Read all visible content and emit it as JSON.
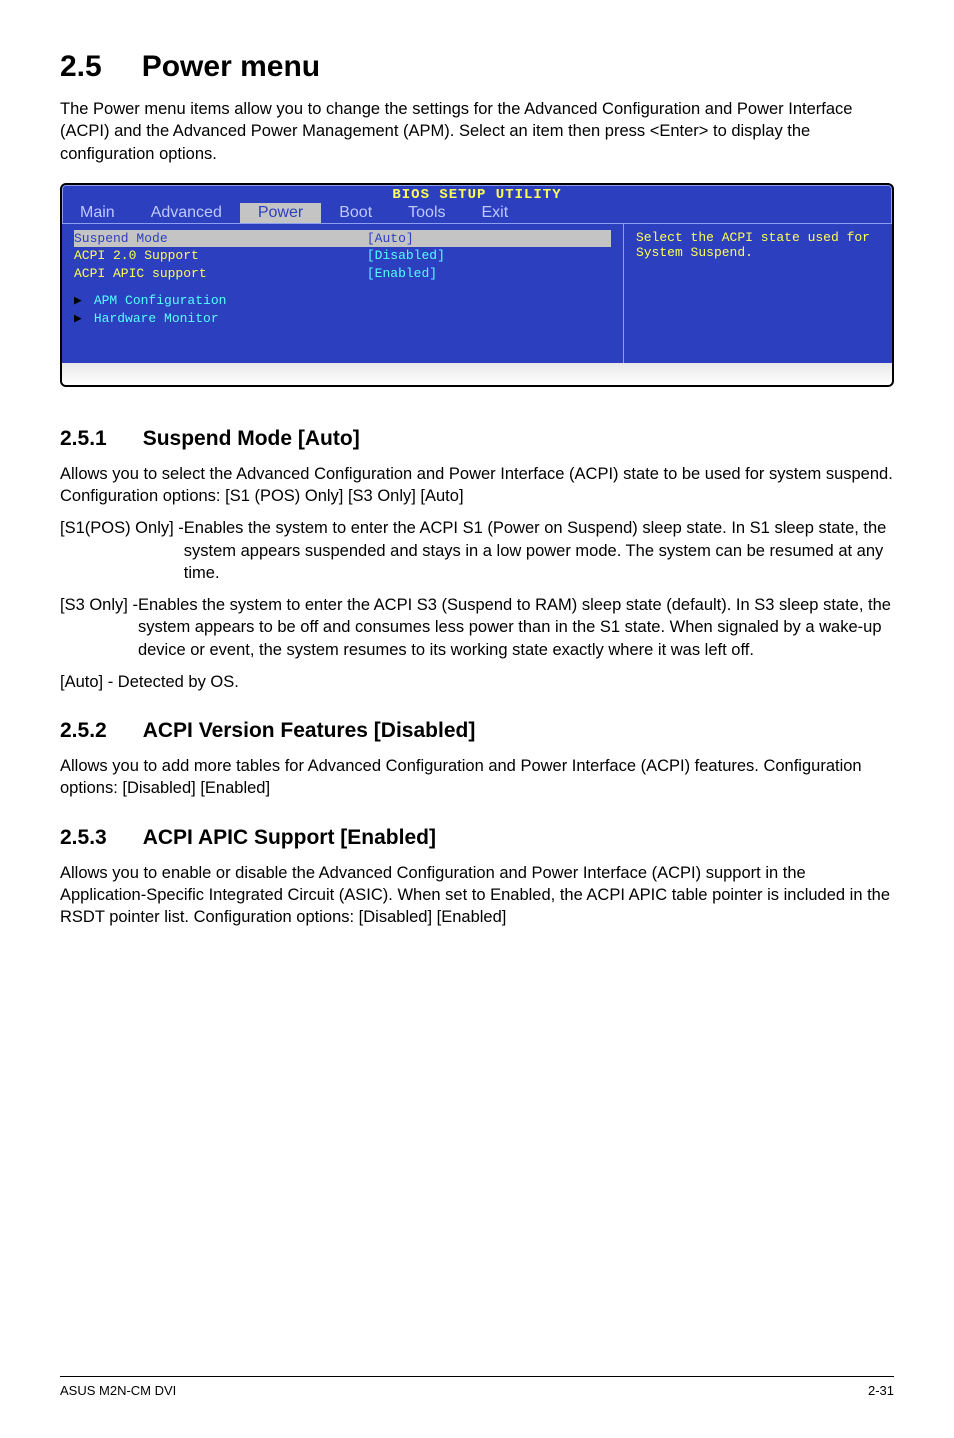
{
  "section": {
    "number": "2.5",
    "title": "Power menu",
    "intro": "The Power menu items allow you to change the settings for the Advanced Configuration and Power Interface (ACPI) and the Advanced Power Management (APM). Select an item then press <Enter> to display the configuration options."
  },
  "bios": {
    "title": "BIOS SETUP UTILITY",
    "tabs": [
      "Main",
      "Advanced",
      "Power",
      "Boot",
      "Tools",
      "Exit"
    ],
    "active_tab_index": 2,
    "rows": [
      {
        "label": "Suspend Mode",
        "value": "[Auto]",
        "selected": true
      },
      {
        "label": "ACPI 2.0 Support",
        "value": "[Disabled]",
        "selected": false
      },
      {
        "label": "ACPI APIC support",
        "value": "[Enabled]",
        "selected": false
      }
    ],
    "submenus": [
      "APM Configuration",
      "Hardware Monitor"
    ],
    "help": "Select the ACPI state used for System Suspend."
  },
  "sub251": {
    "number": "2.5.1",
    "title": "Suspend Mode [Auto]",
    "p1": "Allows you to select the Advanced Configuration and Power Interface (ACPI) state to be used for system suspend. Configuration options: [S1 (POS) Only] [S3 Only] [Auto]",
    "opt1_label": "[S1(POS) Only] - ",
    "opt1_text": "Enables the system to enter the ACPI S1 (Power on Suspend) sleep state. In S1 sleep state, the system appears suspended and stays in a low power mode. The system can be resumed at any time.",
    "opt2_label": "[S3 Only] - ",
    "opt2_text": "Enables the system to enter the ACPI S3 (Suspend to RAM) sleep state (default). In S3 sleep state, the system appears to be off and consumes less power than in the S1 state. When signaled by a wake-up device or event, the system resumes to its working state exactly where it was left off.",
    "opt3": "[Auto] - Detected by OS."
  },
  "sub252": {
    "number": "2.5.2",
    "title": "ACPI Version Features [Disabled]",
    "p1": "Allows you to add more tables for Advanced Configuration and Power Interface (ACPI) features. Configuration options: [Disabled] [Enabled]"
  },
  "sub253": {
    "number": "2.5.3",
    "title": "ACPI APIC Support [Enabled]",
    "p1": "Allows you to enable or disable the Advanced Configuration and Power Interface (ACPI) support in the Application-Specific Integrated Circuit (ASIC). When set to Enabled, the ACPI APIC table pointer is included in the RSDT pointer list. Configuration options: [Disabled] [Enabled]"
  },
  "footer": {
    "left": "ASUS M2N-CM DVI",
    "right": "2-31"
  }
}
